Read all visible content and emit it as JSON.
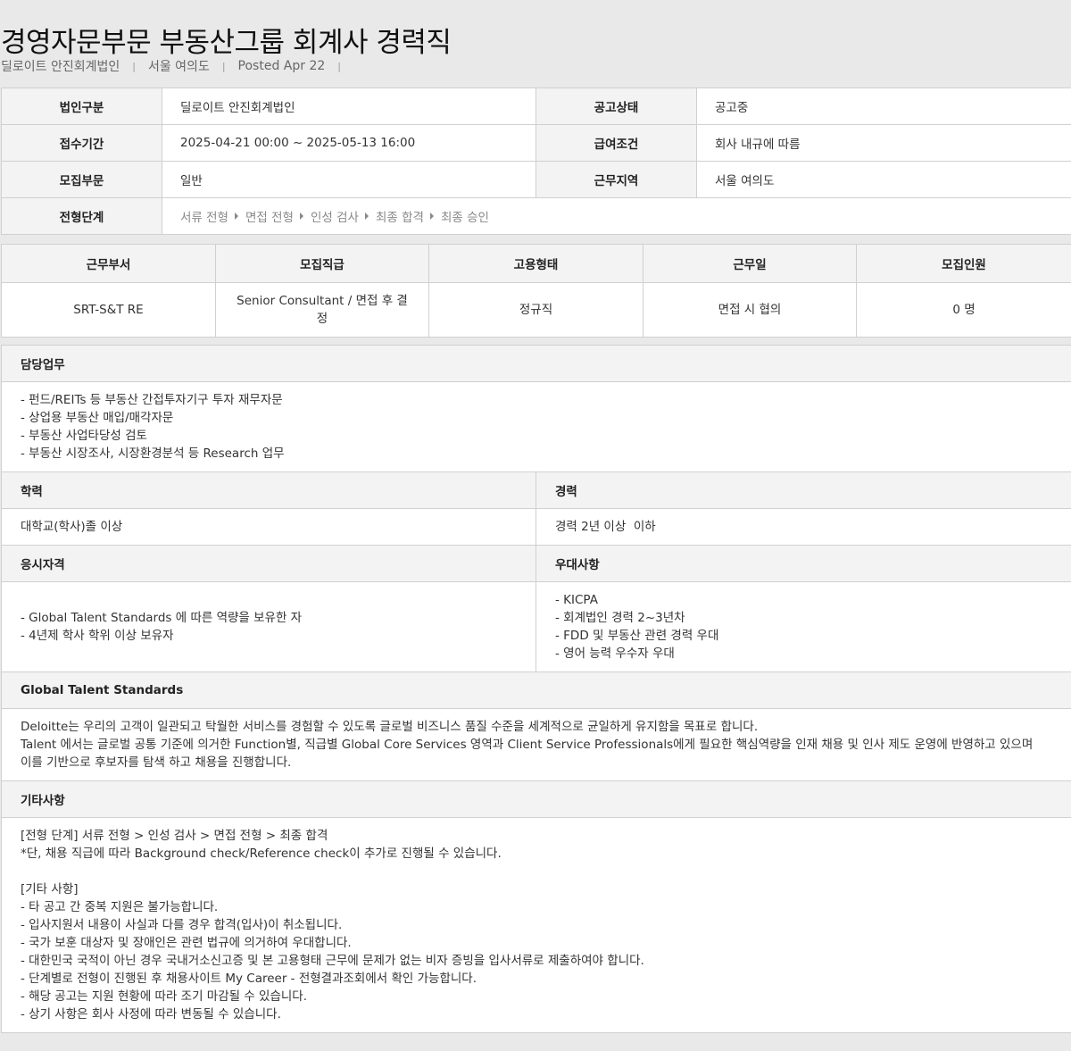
{
  "header": {
    "title": "경영자문부문 부동산그룹 회계사 경력직",
    "company": "딜로이트 안진회계법인",
    "location": "서울 여의도",
    "posted": "Posted Apr 22",
    "separator": "|"
  },
  "info": {
    "corp_label": "법인구분",
    "corp_value": "딜로이트 안진회계법인",
    "status_label": "공고상태",
    "status_value": "공고중",
    "period_label": "접수기간",
    "period_value": "2025-04-21 00:00 ~ 2025-05-13 16:00",
    "salary_label": "급여조건",
    "salary_value": "회사 내규에 따름",
    "dept_label": "모집부문",
    "dept_value": "일반",
    "region_label": "근무지역",
    "region_value": "서울 여의도",
    "stages_label": "전형단계",
    "stages": [
      "서류 전형",
      "면접 전형",
      "인성 검사",
      "최종 합격",
      "최종 승인"
    ]
  },
  "position_table": {
    "headers": [
      "근무부서",
      "모집직급",
      "고용형태",
      "근무일",
      "모집인원"
    ],
    "row": [
      "SRT-S&T RE",
      "Senior Consultant / 면접 후 결정",
      "정규직",
      "면접 시 협의",
      "0 명"
    ]
  },
  "details": {
    "duty_label": "담당업무",
    "duty_lines": [
      "- 펀드/REITs 등 부동산 간접투자기구 투자 재무자문",
      "- 상업용 부동산 매입/매각자문",
      "- 부동산 사업타당성 검토",
      "- 부동산 시장조사, 시장환경분석 등 Research 업무"
    ],
    "edu_label": "학력",
    "edu_value": "대학교(학사)졸 이상",
    "career_label": "경력",
    "career_value": "경력 2년 이상  이하",
    "qual_label": "응시자격",
    "qual_lines": [
      "- Global Talent Standards 에 따른 역량을 보유한 자",
      "- 4년제 학사 학위 이상 보유자"
    ],
    "pref_label": "우대사항",
    "pref_lines": [
      "- KICPA",
      "- 회계법인 경력 2~3년차",
      "- FDD 및 부동산 관련 경력 우대",
      "- 영어 능력 우수자 우대"
    ],
    "gts_label": "Global Talent Standards",
    "gts_lines": [
      "Deloitte는 우리의 고객이 일관되고 탁월한 서비스를 경험할 수 있도록 글로벌 비즈니스 품질 수준을 세계적으로 균일하게 유지함을 목표로 합니다.",
      "Talent 에서는 글로벌 공통 기준에 의거한 Function별, 직급별 Global Core Services 영역과 Client Service Professionals에게 필요한 핵심역량을 인재 채용 및 인사 제도 운영에 반영하고 있으며",
      "이를 기반으로 후보자를 탐색 하고 채용을 진행합니다."
    ],
    "etc_label": "기타사항",
    "etc_lines": [
      "[전형 단계] 서류 전형 > 인성 검사 > 면접 전형 > 최종 합격",
      "*단, 채용 직급에 따라 Background check/Reference check이 추가로 진행될 수 있습니다.",
      " ",
      "[기타 사항]",
      "- 타 공고 간 중복 지원은 불가능합니다.",
      "- 입사지원서 내용이 사실과 다를 경우 합격(입사)이 취소됩니다.",
      "- 국가 보훈 대상자 및 장애인은 관련 법규에 의거하여 우대합니다.",
      "- 대한민국 국적이 아닌 경우 국내거소신고증 및 본 고용형태 근무에 문제가 없는 비자 증빙을 입사서류로 제출하여야 합니다.",
      "- 단계별로 전형이 진행된 후 채용사이트 My Career - 전형결과조회에서 확인 가능합니다.",
      "- 해당 공고는 지원 현황에 따라 조기 마감될 수 있습니다.",
      "- 상기 사항은 회사 사정에 따라 변동될 수 있습니다."
    ]
  }
}
